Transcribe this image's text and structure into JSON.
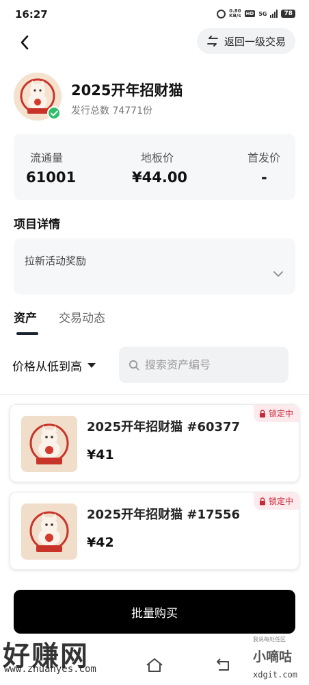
{
  "status_bar": {
    "time": "16:27",
    "speed_value": "0.80",
    "speed_unit": "KB/s",
    "hd": "HD",
    "network": "5G",
    "battery": "78"
  },
  "header": {
    "return_label": "返回一级交易"
  },
  "product": {
    "title": "2025开年招财猫",
    "issue_total": "发行总数 74771份"
  },
  "stats": [
    {
      "label": "流通量",
      "value": "61001"
    },
    {
      "label": "地板价",
      "value": "¥44.00"
    },
    {
      "label": "首发价",
      "value": "-"
    }
  ],
  "details": {
    "section_title": "项目详情",
    "text": "拉新活动奖励"
  },
  "tabs": [
    {
      "label": "资产",
      "active": true
    },
    {
      "label": "交易动态",
      "active": false
    }
  ],
  "sort": {
    "label": "价格从低到高"
  },
  "search": {
    "placeholder": "搜索资产编号"
  },
  "assets": [
    {
      "name": "2025开年招财猫 #60377",
      "price": "¥41",
      "badge": "锁定中"
    },
    {
      "name": "2025开年招财猫 #17556",
      "price": "¥42",
      "badge": "锁定中"
    }
  ],
  "bulk_buy_label": "批量购买",
  "watermarks": {
    "left_big": "好赚网",
    "left_url": "www.zhuanyes.com",
    "right_small": "我说每处任区",
    "right_logo": "小嘀咕",
    "right_url": "xdgit.com"
  },
  "colors": {
    "verified": "#2fbf6a",
    "lock_text": "#c8283a",
    "lock_bg": "#fdeaec",
    "buy_button": "#000000"
  }
}
